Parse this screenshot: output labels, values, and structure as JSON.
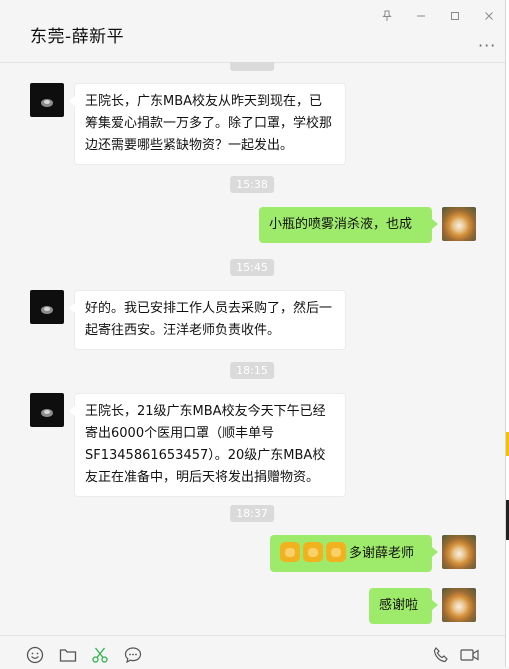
{
  "window": {
    "title": "东莞-薛新平",
    "more_label": "···"
  },
  "icons": {
    "pin": "pin-icon",
    "minimize": "minimize-icon",
    "maximize": "maximize-icon",
    "close": "close-icon",
    "more": "more-icon",
    "emoji": "emoji-icon",
    "folder": "folder-icon",
    "scissors": "scissors-icon",
    "chat_history": "chat-history-icon",
    "voice_call": "phone-icon",
    "video_call": "video-call-icon"
  },
  "colors": {
    "background": "#f5f5f5",
    "sent_bubble": "#9eea6a",
    "received_bubble": "#ffffff",
    "timestamp_bg": "#dadada"
  },
  "messages": [
    {
      "type": "received",
      "text": "王院长，广东MBA校友从昨天到现在，已筹集爱心捐款一万多了。除了口罩，学校那边还需要哪些紧缺物资？一起发出。"
    },
    {
      "type": "time",
      "text": "15:38"
    },
    {
      "type": "sent",
      "text": "小瓶的喷雾消杀液，也成"
    },
    {
      "type": "time",
      "text": "15:45"
    },
    {
      "type": "received",
      "text": "好的。我已安排工作人员去采购了，然后一起寄往西安。汪洋老师负责收件。"
    },
    {
      "type": "time",
      "text": "18:15"
    },
    {
      "type": "received",
      "text": "王院长，21级广东MBA校友今天下午已经寄出6000个医用口罩（顺丰单号SF1345861653457）。20级广东MBA校友正在准备中，明后天将发出捐赠物资。"
    },
    {
      "type": "time",
      "text": "18:37"
    },
    {
      "type": "sent",
      "text": "多谢薛老师",
      "emojis": [
        "fist-emoji",
        "ok-hand-emoji",
        "bow-emoji"
      ]
    },
    {
      "type": "sent",
      "text": "感谢啦"
    }
  ]
}
